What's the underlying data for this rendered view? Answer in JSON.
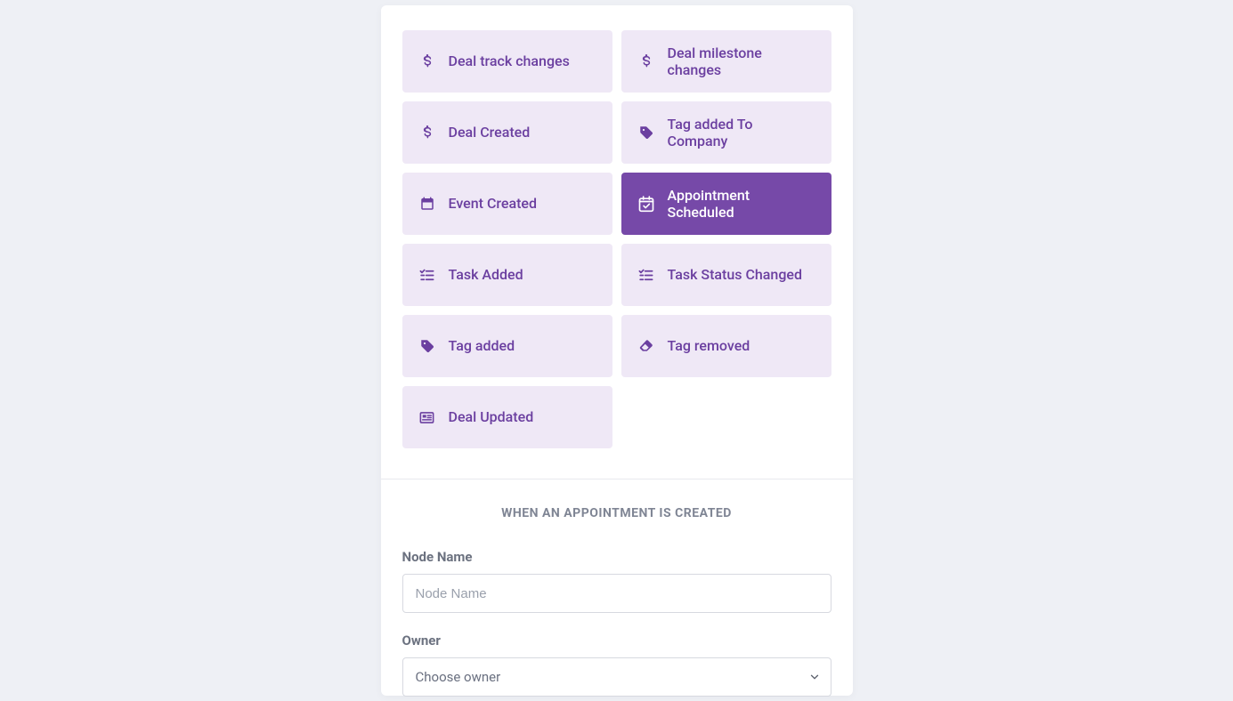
{
  "tiles": [
    {
      "label": "Deal track changes",
      "icon": "dollar"
    },
    {
      "label": "Deal milestone changes",
      "icon": "dollar"
    },
    {
      "label": "Deal Created",
      "icon": "dollar"
    },
    {
      "label": "Tag added To Company",
      "icon": "tag"
    },
    {
      "label": "Event Created",
      "icon": "calendar"
    },
    {
      "label": "Appointment Scheduled",
      "icon": "calendar-check",
      "selected": true
    },
    {
      "label": "Task Added",
      "icon": "task-list"
    },
    {
      "label": "Task Status Changed",
      "icon": "task-list"
    },
    {
      "label": "Tag added",
      "icon": "tag"
    },
    {
      "label": "Tag removed",
      "icon": "eraser"
    },
    {
      "label": "Deal Updated",
      "icon": "news"
    }
  ],
  "section": {
    "heading": "WHEN AN APPOINTMENT IS CREATED",
    "nodeName": {
      "label": "Node Name",
      "placeholder": "Node Name",
      "value": ""
    },
    "owner": {
      "label": "Owner",
      "placeholder": "Choose owner"
    }
  }
}
